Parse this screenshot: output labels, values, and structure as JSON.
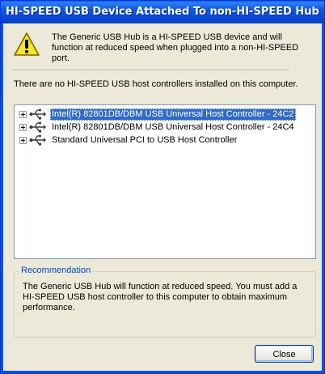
{
  "window": {
    "title": "HI-SPEED USB Device Attached To non-HI-SPEED Hub"
  },
  "header": {
    "icon": "warning-icon",
    "message": "The Generic USB Hub is a HI-SPEED USB device and will function at reduced speed when plugged into a non-HI-SPEED port."
  },
  "status_text": "There are no HI-SPEED USB host controllers installed on this computer.",
  "tree": {
    "items": [
      {
        "label": "Intel(R) 82801DB/DBM USB Universal Host Controller - 24C2",
        "selected": true,
        "icon": "usb-icon"
      },
      {
        "label": "Intel(R) 82801DB/DBM USB Universal Host Controller - 24C4",
        "selected": false,
        "icon": "usb-icon"
      },
      {
        "label": "Standard Universal PCI to USB Host Controller",
        "selected": false,
        "icon": "usb-icon"
      }
    ]
  },
  "recommendation": {
    "title": "Recommendation",
    "text": "The Generic USB Hub will function at reduced speed. You must add a HI-SPEED USB host controller to this computer to obtain maximum performance."
  },
  "buttons": {
    "close_label": "Close"
  },
  "colors": {
    "title_bar": "#0a5fe8",
    "selection": "#316ac5",
    "group_title": "#0046d5"
  }
}
